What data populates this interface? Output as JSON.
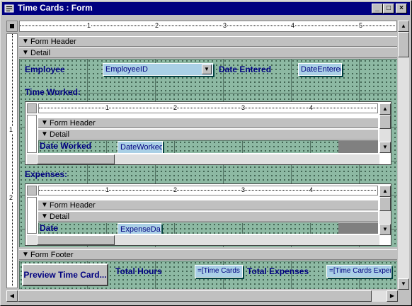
{
  "window": {
    "title": "Time Cards : Form",
    "min_glyph": "_",
    "max_glyph": "□",
    "close_glyph": "×"
  },
  "ruler": {
    "marks": [
      "1",
      "2",
      "3",
      "4",
      "5"
    ],
    "vmarks": [
      "1",
      "2"
    ]
  },
  "sections": {
    "form_header": "Form Header",
    "detail": "Detail",
    "form_footer": "Form Footer"
  },
  "main": {
    "employee_label": "Employee",
    "employee_field": "EmployeeID",
    "date_entered_label": "Date Entered",
    "date_entered_field": "DateEntered",
    "time_worked_label": "Time Worked:",
    "expenses_label": "Expenses:"
  },
  "time_subform": {
    "ruler_marks": [
      "1",
      "2",
      "3",
      "4"
    ],
    "form_header": "Form Header",
    "detail": "Detail",
    "date_label": "Date Worked",
    "date_field": "DateWorked"
  },
  "expense_subform": {
    "ruler_marks": [
      "1",
      "2",
      "3",
      "4"
    ],
    "form_header": "Form Header",
    "detail": "Detail",
    "date_label": "Date",
    "date_field": "ExpenseDate"
  },
  "footer": {
    "preview_button": "Preview Time Card...",
    "total_hours_label": "Total Hours",
    "total_hours_field": "=[Time Cards S",
    "total_expenses_label": "Total Expenses",
    "total_expenses_field": "=[Time Cards Expen"
  },
  "colors": {
    "titlebar": "#000080",
    "grid": "#8db9a3",
    "control": "#aad0e6",
    "label_text": "#000080"
  }
}
